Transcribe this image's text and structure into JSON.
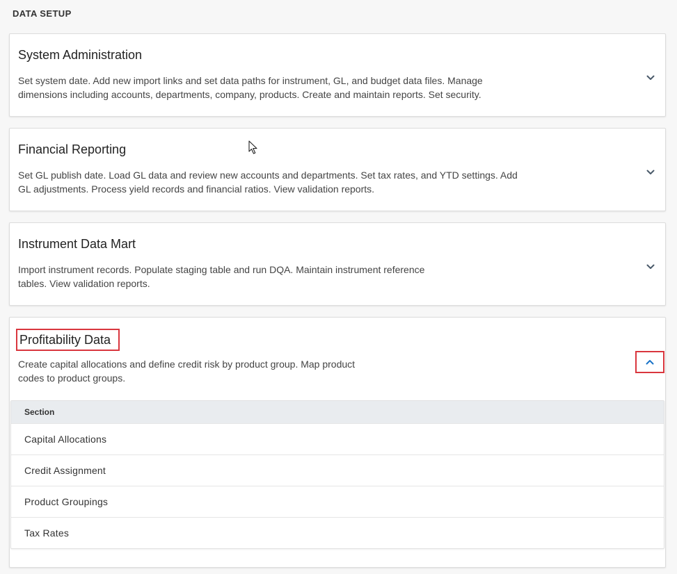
{
  "header": {
    "title": "DATA SETUP"
  },
  "cards": [
    {
      "title": "System Administration",
      "description_lines": [
        "Set system date. Add new import links and set data paths for instrument, GL, and budget data files. Manage",
        "dimensions including accounts, departments, company, products. Create and maintain reports. Set security."
      ],
      "toggle_icon": "chevron-down-icon",
      "expanded": false
    },
    {
      "title": "Financial Reporting",
      "description_lines": [
        "Set GL publish date. Load GL data and review new accounts and departments. Set tax rates, and YTD settings. Add",
        "GL adjustments. Process yield records and financial ratios. View validation reports."
      ],
      "toggle_icon": "chevron-down-icon",
      "expanded": false
    },
    {
      "title": "Instrument Data Mart",
      "description_lines": [
        "Import instrument records. Populate staging table and run DQA. Maintain instrument reference",
        "tables. View validation reports."
      ],
      "toggle_icon": "chevron-down-icon",
      "expanded": false
    },
    {
      "title": "Profitability Data",
      "description_lines": [
        "Create capital allocations and define credit risk by product group. Map product",
        "codes to product groups."
      ],
      "toggle_icon": "chevron-up-icon",
      "expanded": true,
      "table": {
        "column_header": "Section",
        "rows": [
          "Capital Allocations",
          "Credit Assignment",
          "Product Groupings",
          "Tax Rates"
        ]
      }
    }
  ],
  "colors": {
    "highlight_border": "#d9363e",
    "chevron_down": "#4a5a6a",
    "chevron_up": "#1a73c8",
    "table_header_bg": "#e9ecef"
  }
}
